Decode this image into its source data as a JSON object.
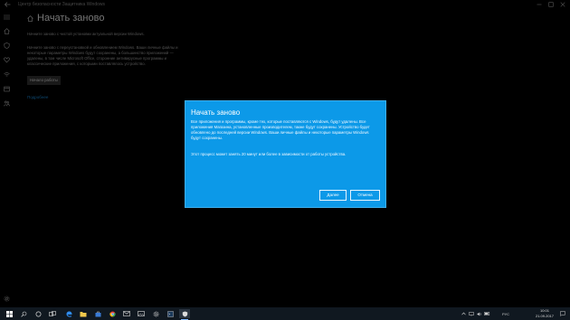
{
  "window": {
    "title": "Центр безопасности Защитника Windows"
  },
  "page": {
    "title": "Начать заново",
    "subtitle": "Начните заново с чистой установки актуальной версии Windows.",
    "description": "Начните заново с переустановкой и обновлением Windows. Ваши личные файлы и некоторые параметры Windows будут сохранены, а большинство приложений — удалены, в том числе Microsoft Office, сторонние антивирусные программы и классические приложения, с которыми поставлялось устройство.",
    "start_button": "Начало работы",
    "more_link": "Подробнее"
  },
  "dialog": {
    "title": "Начать заново",
    "body": "Все приложения и программы, кроме тех, которые поставляются с Windows, будут удалены. Все приложения Магазина, установленные производителем, также будут сохранены. Устройство будет обновлено до последней версии Windows. Ваши личные файлы и некоторые параметры Windows будут сохранены.",
    "note": "Этот процесс может занять 20 минут или более в зависимости от работы устройства.",
    "next_button": "Далее",
    "cancel_button": "Отмена"
  },
  "taskbar": {
    "language": "РУС",
    "time": "10:01",
    "date": "21.09.2017",
    "items": [
      "start-icon",
      "search-icon",
      "cortana-icon",
      "task-view-icon",
      "edge-icon",
      "explorer-icon",
      "store-icon",
      "chrome-icon",
      "mail-icon",
      "photos-icon",
      "settings-icon",
      "terminal-icon",
      "security-icon"
    ]
  },
  "colors": {
    "dialog_bg": "#0c99e8",
    "accent_link": "#1a8fe0",
    "background": "#000000",
    "taskbar": "#101820"
  }
}
